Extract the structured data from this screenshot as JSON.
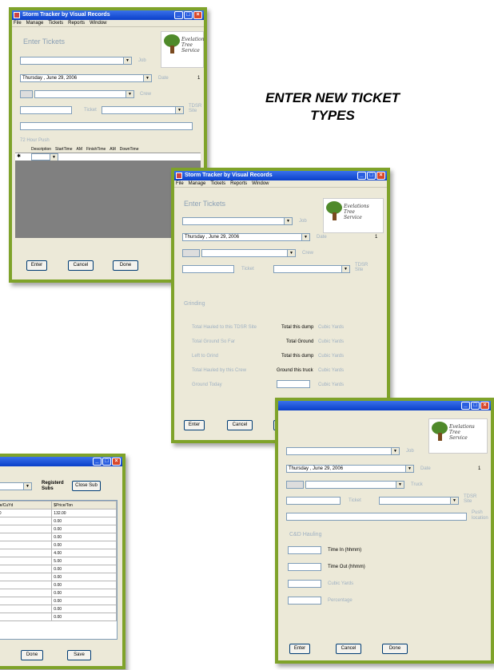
{
  "slogan": {
    "line1": "ENTER NEW TICKET",
    "line2": "TYPES"
  },
  "logo": {
    "line1": "Evelations",
    "line2": "Tree",
    "line3": "Service"
  },
  "window_title": "Storm Tracker by Visual Records",
  "menu": [
    "File",
    "Manage",
    "Tickets",
    "Reports",
    "Window"
  ],
  "labels": {
    "header": "Enter Tickets",
    "job": "Job",
    "date": "Date",
    "crew": "Crew",
    "truck": "Truck",
    "ticket": "Ticket",
    "tdsr": "TDSR",
    "site": "Site",
    "push": "Push",
    "location": "location",
    "hour72": "72 Hour Push"
  },
  "values": {
    "date": "Thursday ,    June    29, 2006",
    "counter": "1"
  },
  "grid_cols": [
    "Description",
    "StartTime",
    "AM",
    "FinishTime",
    "AM",
    "DownTime"
  ],
  "buttons": {
    "enter": "Enter",
    "cancel": "Cancel",
    "done": "Done",
    "save": "Save",
    "close_sub": "Close Sub"
  },
  "grinding": {
    "title": "Grinding",
    "rows": [
      {
        "label": "Total Hauled to this TDSR Site",
        "mid": "Total this dump",
        "unit": "Cubic Yards"
      },
      {
        "label": "Total Ground So Far",
        "mid": "Total Ground",
        "unit": "Cubic Yards"
      },
      {
        "label": "Left to Grind",
        "mid": "Total this dump",
        "unit": "Cubic Yards"
      },
      {
        "label": "Total Hauled by this Crew",
        "mid": "Ground this truck",
        "unit": "Cubic Yards"
      },
      {
        "label": "Ground Today",
        "mid": "",
        "unit": "Cubic Yards"
      }
    ]
  },
  "cd": {
    "title": "C&D Hauling",
    "rows": [
      "Time In (hhmm)",
      "Time Out (hhmm)",
      "Cubic Yards",
      "Percentage"
    ]
  },
  "registered": {
    "line1": "Registerd",
    "line2": "Subs"
  },
  "price_table": {
    "headers": [
      "ice/CuYd",
      "$Price/Ton"
    ],
    "rows": [
      [
        "00",
        "132.00"
      ],
      [
        "",
        "0.00"
      ],
      [
        "",
        "0.00"
      ],
      [
        "",
        "0.00"
      ],
      [
        "",
        "0.00"
      ],
      [
        "",
        "4.00"
      ],
      [
        "",
        "5.00"
      ],
      [
        "",
        "0.00"
      ],
      [
        "",
        "0.00"
      ],
      [
        "",
        "0.00"
      ],
      [
        "",
        "0.00"
      ],
      [
        "",
        "0.00"
      ],
      [
        "",
        "0.00"
      ],
      [
        "",
        "0.00"
      ]
    ]
  },
  "colors": {
    "border": "#7fa32a",
    "titlebar": "#0a3fc9",
    "label": "#9eb0c2"
  }
}
